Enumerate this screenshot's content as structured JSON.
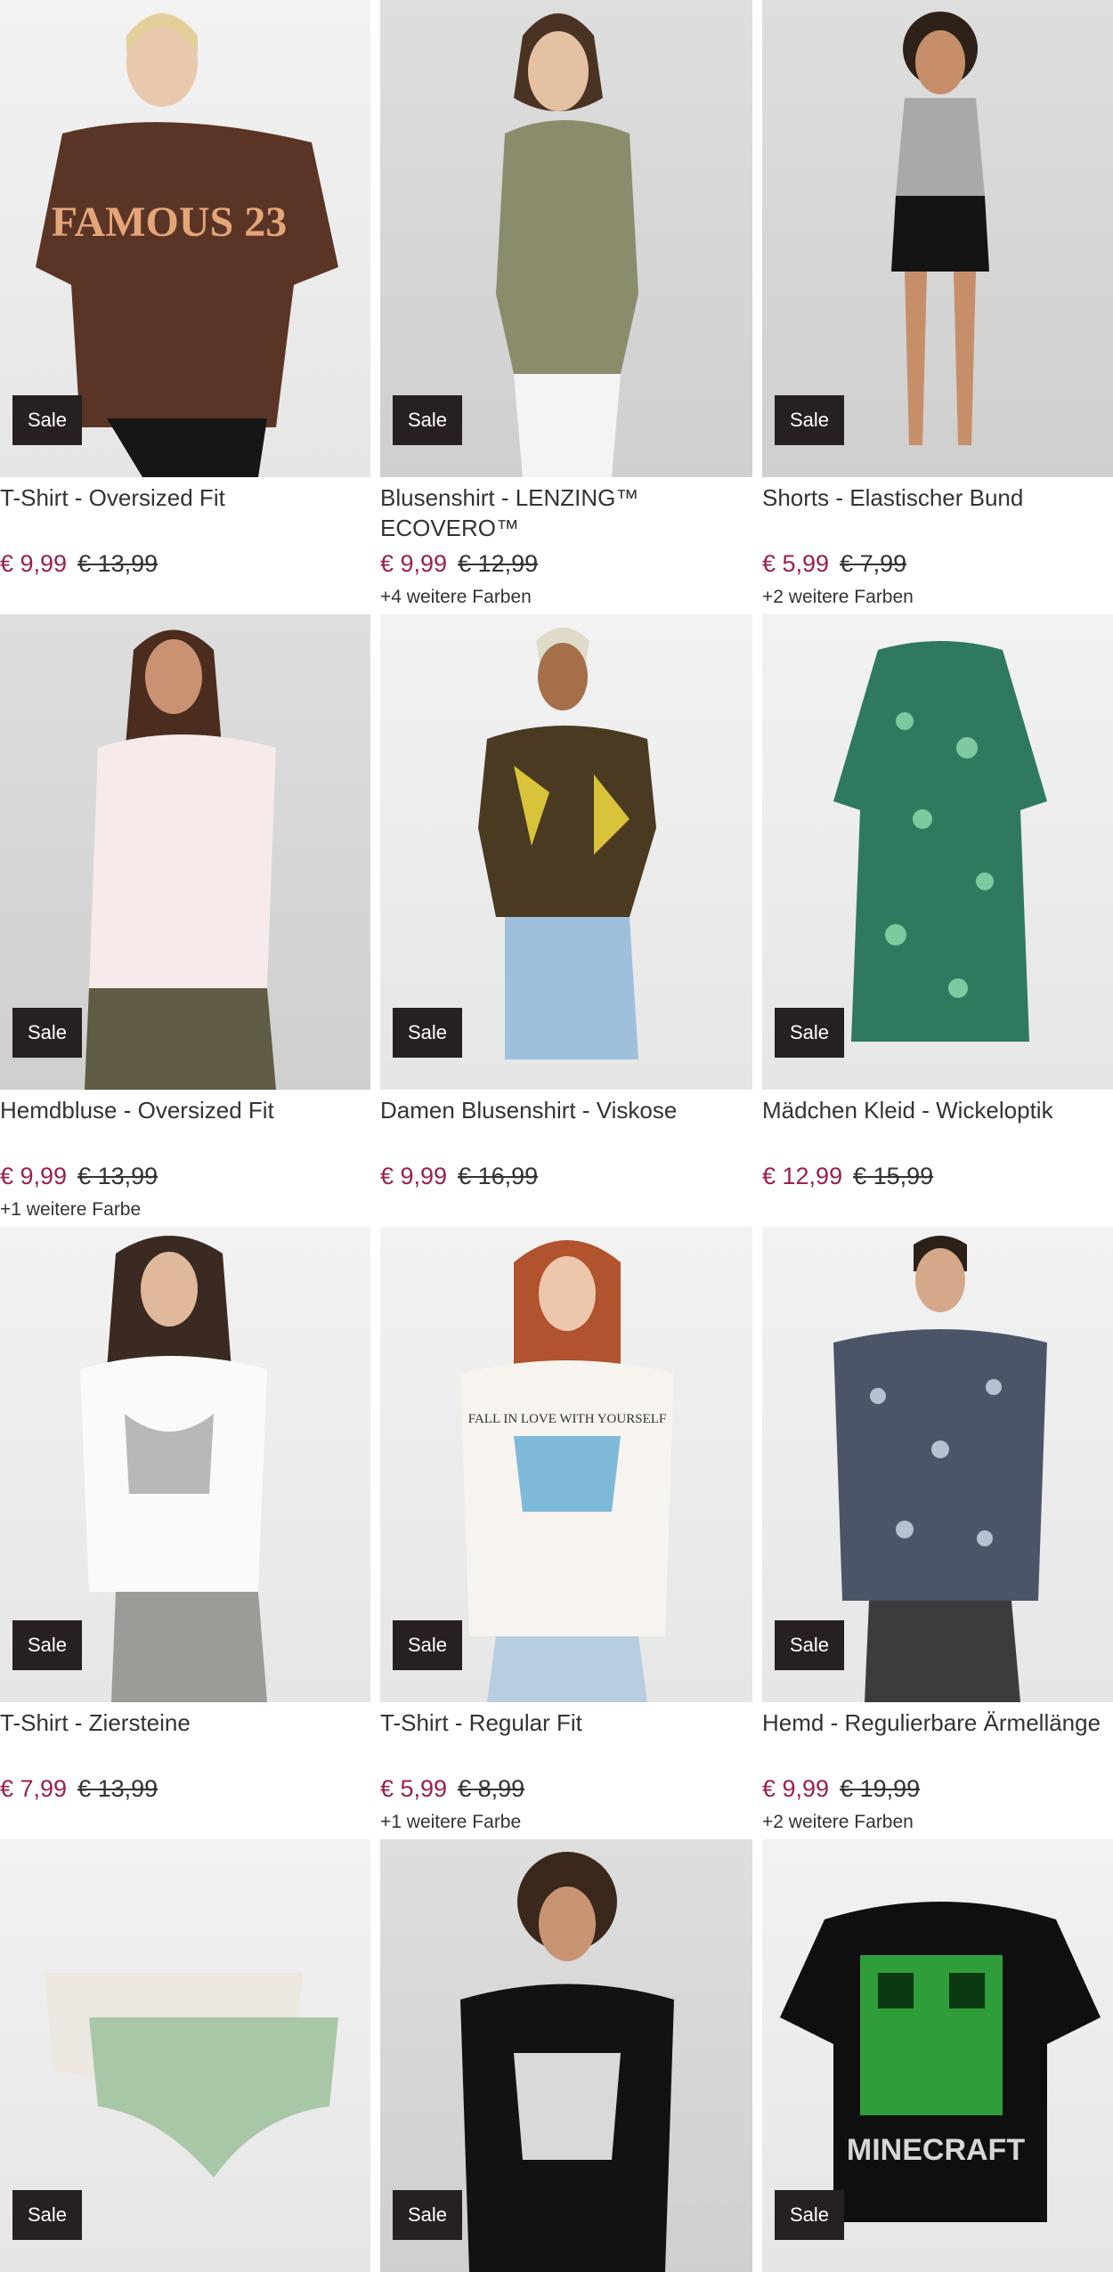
{
  "badge": "Sale",
  "products": [
    {
      "title": "T-Shirt - Oversized Fit",
      "price": "€ 9,99",
      "old_price": "€ 13,99",
      "colors": ""
    },
    {
      "title": "Blusenshirt - LENZING™ ECOVERO™",
      "price": "€ 9,99",
      "old_price": "€ 12,99",
      "colors": "+4 weitere Farben"
    },
    {
      "title": "Shorts - Elastischer Bund",
      "price": "€ 5,99",
      "old_price": "€ 7,99",
      "colors": "+2 weitere Farben"
    },
    {
      "title": "Hemdbluse - Oversized Fit",
      "price": "€ 9,99",
      "old_price": "€ 13,99",
      "colors": "+1 weitere Farbe"
    },
    {
      "title": "Damen Blusenshirt - Viskose",
      "price": "€ 9,99",
      "old_price": "€ 16,99",
      "colors": ""
    },
    {
      "title": "Mädchen Kleid - Wickeloptik",
      "price": "€ 12,99",
      "old_price": "€ 15,99",
      "colors": ""
    },
    {
      "title": "T-Shirt - Ziersteine",
      "price": "€ 7,99",
      "old_price": "€ 13,99",
      "colors": ""
    },
    {
      "title": "T-Shirt - Regular Fit",
      "price": "€ 5,99",
      "old_price": "€ 8,99",
      "colors": "+1 weitere Farbe"
    },
    {
      "title": "Hemd - Regulierbare Ärmellänge",
      "price": "€ 9,99",
      "old_price": "€ 19,99",
      "colors": "+2 weitere Farben"
    },
    {
      "title": "",
      "price": "",
      "old_price": "",
      "colors": ""
    },
    {
      "title": "",
      "price": "",
      "old_price": "",
      "colors": ""
    },
    {
      "title": "",
      "price": "",
      "old_price": "",
      "colors": ""
    }
  ],
  "images": [
    {
      "print_text": "FAMOUS 23"
    },
    {
      "print_text": ""
    },
    {
      "print_text": ""
    },
    {
      "print_text": ""
    },
    {
      "print_text": ""
    },
    {
      "print_text": ""
    },
    {
      "print_text": ""
    },
    {
      "print_text": "FALL IN LOVE WITH YOURSELF"
    },
    {
      "print_text": ""
    },
    {
      "print_text": ""
    },
    {
      "print_text": ""
    },
    {
      "print_text": "MINECRAFT"
    }
  ],
  "colors": {
    "sale": "#9b1f50",
    "badge_bg": "#262120"
  }
}
